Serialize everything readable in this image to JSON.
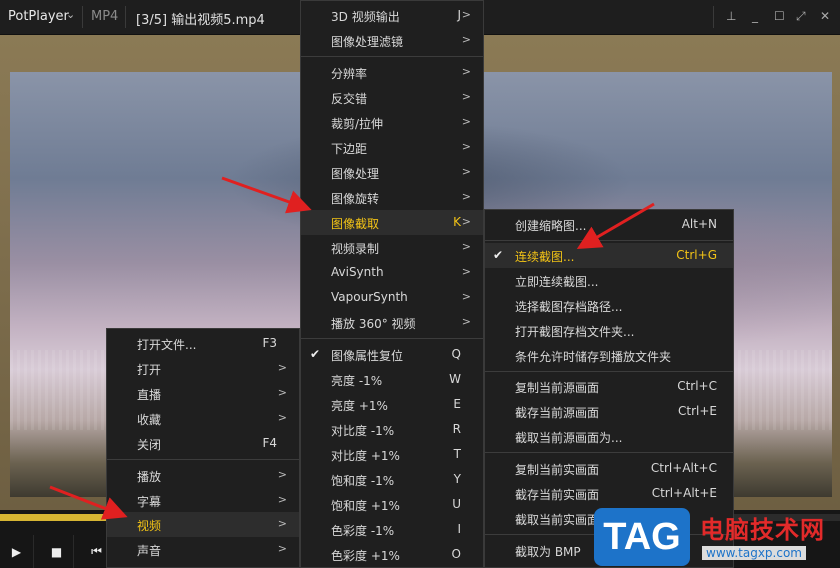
{
  "titlebar": {
    "app_name": "PotPlayer",
    "format": "MP4",
    "filename": "[3/5] 输出视频5.mp4"
  },
  "playback": {
    "progress_fraction": 0.13
  },
  "menu1": {
    "items": [
      {
        "label": "打开文件...",
        "shortcut": "F3",
        "arrow": ""
      },
      {
        "label": "打开",
        "shortcut": "",
        "arrow": ">"
      },
      {
        "label": "直播",
        "shortcut": "",
        "arrow": ">"
      },
      {
        "label": "收藏",
        "shortcut": "",
        "arrow": ">"
      },
      {
        "label": "关闭",
        "shortcut": "F4",
        "arrow": ""
      },
      {
        "label": "播放",
        "shortcut": "",
        "arrow": ">"
      },
      {
        "label": "字幕",
        "shortcut": "",
        "arrow": ">"
      },
      {
        "label": "视频",
        "shortcut": "",
        "arrow": ">"
      },
      {
        "label": "声音",
        "shortcut": "",
        "arrow": ">"
      }
    ]
  },
  "menu2": {
    "items": [
      {
        "label": "3D 视频输出",
        "shortcut": "J",
        "arrow": ">"
      },
      {
        "label": "图像处理滤镜",
        "shortcut": "",
        "arrow": ">"
      },
      {
        "label": "分辨率",
        "shortcut": "",
        "arrow": ">"
      },
      {
        "label": "反交错",
        "shortcut": "",
        "arrow": ">"
      },
      {
        "label": "裁剪/拉伸",
        "shortcut": "",
        "arrow": ">"
      },
      {
        "label": "下边距",
        "shortcut": "",
        "arrow": ">"
      },
      {
        "label": "图像处理",
        "shortcut": "",
        "arrow": ">"
      },
      {
        "label": "图像旋转",
        "shortcut": "",
        "arrow": ">"
      },
      {
        "label": "图像截取",
        "shortcut": "K",
        "arrow": ">"
      },
      {
        "label": "视频录制",
        "shortcut": "",
        "arrow": ">"
      },
      {
        "label": "AviSynth",
        "shortcut": "",
        "arrow": ">"
      },
      {
        "label": "VapourSynth",
        "shortcut": "",
        "arrow": ">"
      },
      {
        "label": "播放 360° 视频",
        "shortcut": "",
        "arrow": ">"
      },
      {
        "label": "图像属性复位",
        "shortcut": "Q",
        "arrow": ""
      },
      {
        "label": "亮度 -1%",
        "shortcut": "W",
        "arrow": ""
      },
      {
        "label": "亮度 +1%",
        "shortcut": "E",
        "arrow": ""
      },
      {
        "label": "对比度 -1%",
        "shortcut": "R",
        "arrow": ""
      },
      {
        "label": "对比度 +1%",
        "shortcut": "T",
        "arrow": ""
      },
      {
        "label": "饱和度 -1%",
        "shortcut": "Y",
        "arrow": ""
      },
      {
        "label": "饱和度 +1%",
        "shortcut": "U",
        "arrow": ""
      },
      {
        "label": "色彩度 -1%",
        "shortcut": "I",
        "arrow": ""
      },
      {
        "label": "色彩度 +1%",
        "shortcut": "O",
        "arrow": ""
      }
    ]
  },
  "menu3": {
    "items": [
      {
        "label": "创建缩略图...",
        "shortcut": "Alt+N"
      },
      {
        "label": "连续截图...",
        "shortcut": "Ctrl+G"
      },
      {
        "label": "立即连续截图...",
        "shortcut": ""
      },
      {
        "label": "选择截图存档路径...",
        "shortcut": ""
      },
      {
        "label": "打开截图存档文件夹...",
        "shortcut": ""
      },
      {
        "label": "条件允许时储存到播放文件夹",
        "shortcut": ""
      },
      {
        "label": "复制当前源画面",
        "shortcut": "Ctrl+C"
      },
      {
        "label": "截存当前源画面",
        "shortcut": "Ctrl+E"
      },
      {
        "label": "截取当前源画面为...",
        "shortcut": ""
      },
      {
        "label": "复制当前实画面",
        "shortcut": "Ctrl+Alt+C"
      },
      {
        "label": "截存当前实画面",
        "shortcut": "Ctrl+Alt+E"
      },
      {
        "label": "截取当前实画面",
        "shortcut": ""
      },
      {
        "label": "截取为 BMP",
        "shortcut": ""
      }
    ]
  },
  "watermark": {
    "logo_text": "TAG",
    "title": "电脑技术网",
    "url": "www.tagxp.com"
  },
  "colors": {
    "highlight": "#f2c316",
    "arrow": "#e02020",
    "brand_blue": "#1d73c9"
  }
}
